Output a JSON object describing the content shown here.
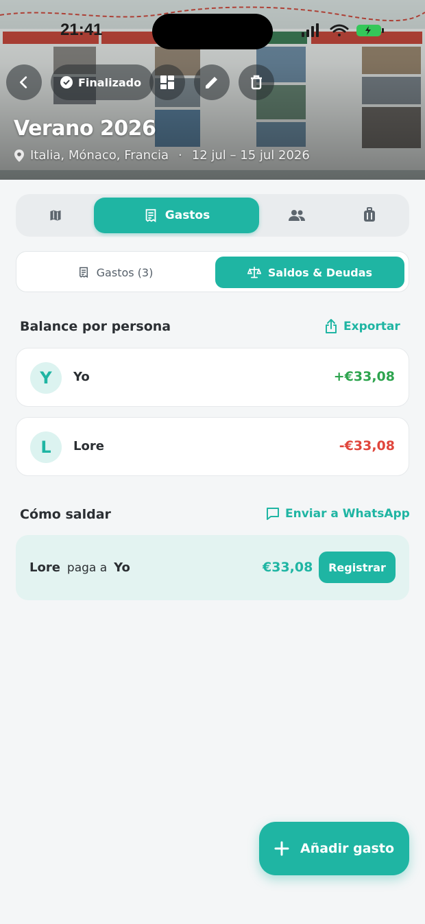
{
  "status_bar": {
    "time": "21:41"
  },
  "hero": {
    "status_label": "Finalizado",
    "title": "Verano 2026",
    "locations": "Italia, Mónaco, Francia",
    "dates": "12 jul – 15 jul 2026",
    "separator": "·"
  },
  "main_tabs": [
    {
      "icon": "map-icon"
    },
    {
      "icon": "receipt-icon",
      "label": "Gastos",
      "active": true
    },
    {
      "icon": "people-icon"
    },
    {
      "icon": "luggage-icon"
    }
  ],
  "sub_tabs": {
    "expenses_label": "Gastos (3)",
    "balances_label": "Saldos & Deudas"
  },
  "balance": {
    "title": "Balance por persona",
    "export_label": "Exportar",
    "people": [
      {
        "initial": "Y",
        "name": "Yo",
        "amount": "+€33,08"
      },
      {
        "initial": "L",
        "name": "Lore",
        "amount": "-€33,08"
      }
    ]
  },
  "settle": {
    "title": "Cómo saldar",
    "whatsapp_label": "Enviar a WhatsApp",
    "from": "Lore",
    "verb": "paga a",
    "to": "Yo",
    "amount": "€33,08",
    "register_label": "Registrar"
  },
  "fab": {
    "label": "Añadir gasto"
  },
  "colors": {
    "accent": "#1fb5a3",
    "positive": "#2da44e",
    "negative": "#e0463c"
  }
}
